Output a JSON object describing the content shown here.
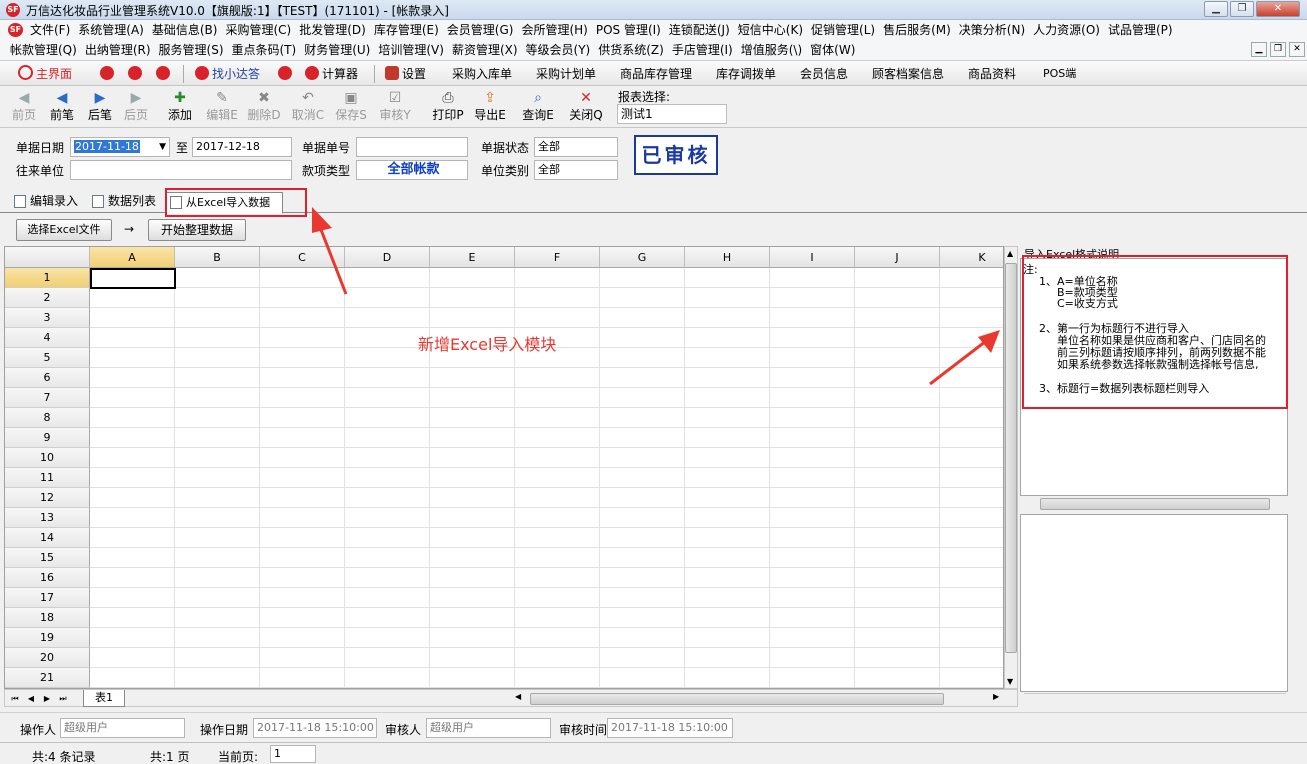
{
  "window": {
    "title": "万信达化妆品行业管理系统V10.0【旗舰版:1】【TEST】(171101) - [帐款录入]",
    "logo_text": "SF"
  },
  "menu_row1": [
    "文件(F)",
    "系统管理(A)",
    "基础信息(B)",
    "采购管理(C)",
    "批发管理(D)",
    "库存管理(E)",
    "会员管理(G)",
    "会所管理(H)",
    "POS 管理(I)",
    "连锁配送(J)",
    "短信中心(K)",
    "促销管理(L)",
    "售后服务(M)",
    "决策分析(N)",
    "人力资源(O)",
    "试品管理(P)"
  ],
  "menu_row2": [
    "帐款管理(Q)",
    "出纳管理(R)",
    "服务管理(S)",
    "重点条码(T)",
    "财务管理(U)",
    "培训管理(V)",
    "薪资管理(X)",
    "等级会员(Y)",
    "供货系统(Z)",
    "手店管理(I)",
    "增值服务(\\)",
    "窗体(W)"
  ],
  "quickbar": {
    "home": "主界面",
    "find": "找小达答",
    "calculator": "计算器",
    "settings": "设置",
    "links": [
      "采购入库单",
      "采购计划单",
      "商品库存管理",
      "库存调拨单",
      "会员信息",
      "顾客档案信息",
      "商品资料",
      "POS端"
    ]
  },
  "toolbar": {
    "buttons": [
      {
        "label": "前页",
        "glyph": "◀",
        "enabled": false
      },
      {
        "label": "前笔",
        "glyph": "◀",
        "enabled": true
      },
      {
        "label": "后笔",
        "glyph": "▶",
        "enabled": true
      },
      {
        "label": "后页",
        "glyph": "▶",
        "enabled": false
      },
      {
        "label": "添加",
        "glyph": "✚",
        "enabled": true
      },
      {
        "label": "编辑E",
        "glyph": "✎",
        "enabled": false
      },
      {
        "label": "删除D",
        "glyph": "✖",
        "enabled": false
      },
      {
        "label": "取消C",
        "glyph": "↶",
        "enabled": false
      },
      {
        "label": "保存S",
        "glyph": "▣",
        "enabled": false
      },
      {
        "label": "审核Y",
        "glyph": "☑",
        "enabled": false
      },
      {
        "label": "打印P",
        "glyph": "⎙",
        "enabled": true
      },
      {
        "label": "导出E",
        "glyph": "⇪",
        "enabled": true
      },
      {
        "label": "查询E",
        "glyph": "⌕",
        "enabled": true
      },
      {
        "label": "关闭Q",
        "glyph": "✕",
        "enabled": true
      }
    ],
    "report_label": "报表选择:",
    "report_value": "测试1"
  },
  "form": {
    "date_label": "单据日期",
    "date_from": "2017-11-18",
    "to_label": "至",
    "date_to": "2017-12-18",
    "number_label": "单据单号",
    "number_value": "",
    "status_label": "单据状态",
    "status_value": "全部",
    "partner_label": "往来单位",
    "partner_value": "",
    "type_label": "款项类型",
    "type_value": "全部帐款",
    "category_label": "单位类别",
    "category_value": "全部",
    "stamp": "已审核"
  },
  "tabs": [
    "编辑录入",
    "数据列表",
    "从Excel导入数据"
  ],
  "actions": {
    "select_file": "选择Excel文件",
    "arrow": "→",
    "start": "开始整理数据"
  },
  "sheet": {
    "columns": [
      "A",
      "B",
      "C",
      "D",
      "E",
      "F",
      "G",
      "H",
      "I",
      "J",
      "K"
    ],
    "rows": [
      "1",
      "2",
      "3",
      "4",
      "5",
      "6",
      "7",
      "8",
      "9",
      "10",
      "11",
      "12",
      "13",
      "14",
      "15",
      "16",
      "17",
      "18",
      "19",
      "20",
      "21"
    ],
    "tab": "表1"
  },
  "notes": {
    "title": "导入Excel格式说明",
    "lines": [
      "注:",
      "1、A=单位名称",
      "B=款项类型",
      "C=收支方式",
      "2、第一行为标题行不进行导入",
      "单位名称如果是供应商和客户、门店同名的",
      "前三列标题请按顺序排列，前两列数据不能",
      "如果系统参数选择帐款强制选择帐号信息,",
      "3、标题行=数据列表标题栏则导入"
    ]
  },
  "annotation": "新增Excel导入模块",
  "footer": {
    "operator_label": "操作人",
    "operator_value": "超级用户",
    "opdate_label": "操作日期",
    "opdate_value": "2017-11-18 15:10:00",
    "auditor_label": "审核人",
    "auditor_value": "超级用户",
    "audittime_label": "审核时间",
    "audittime_value": "2017-11-18 15:10:00"
  },
  "status": {
    "records": "共:4 条记录",
    "pages": "共:1 页",
    "current_label": "当前页:",
    "current_value": "1"
  },
  "colors": {
    "accent_red": "#e0202a",
    "stamp_blue": "#1a3aa0",
    "type_blue": "#1040c0"
  }
}
